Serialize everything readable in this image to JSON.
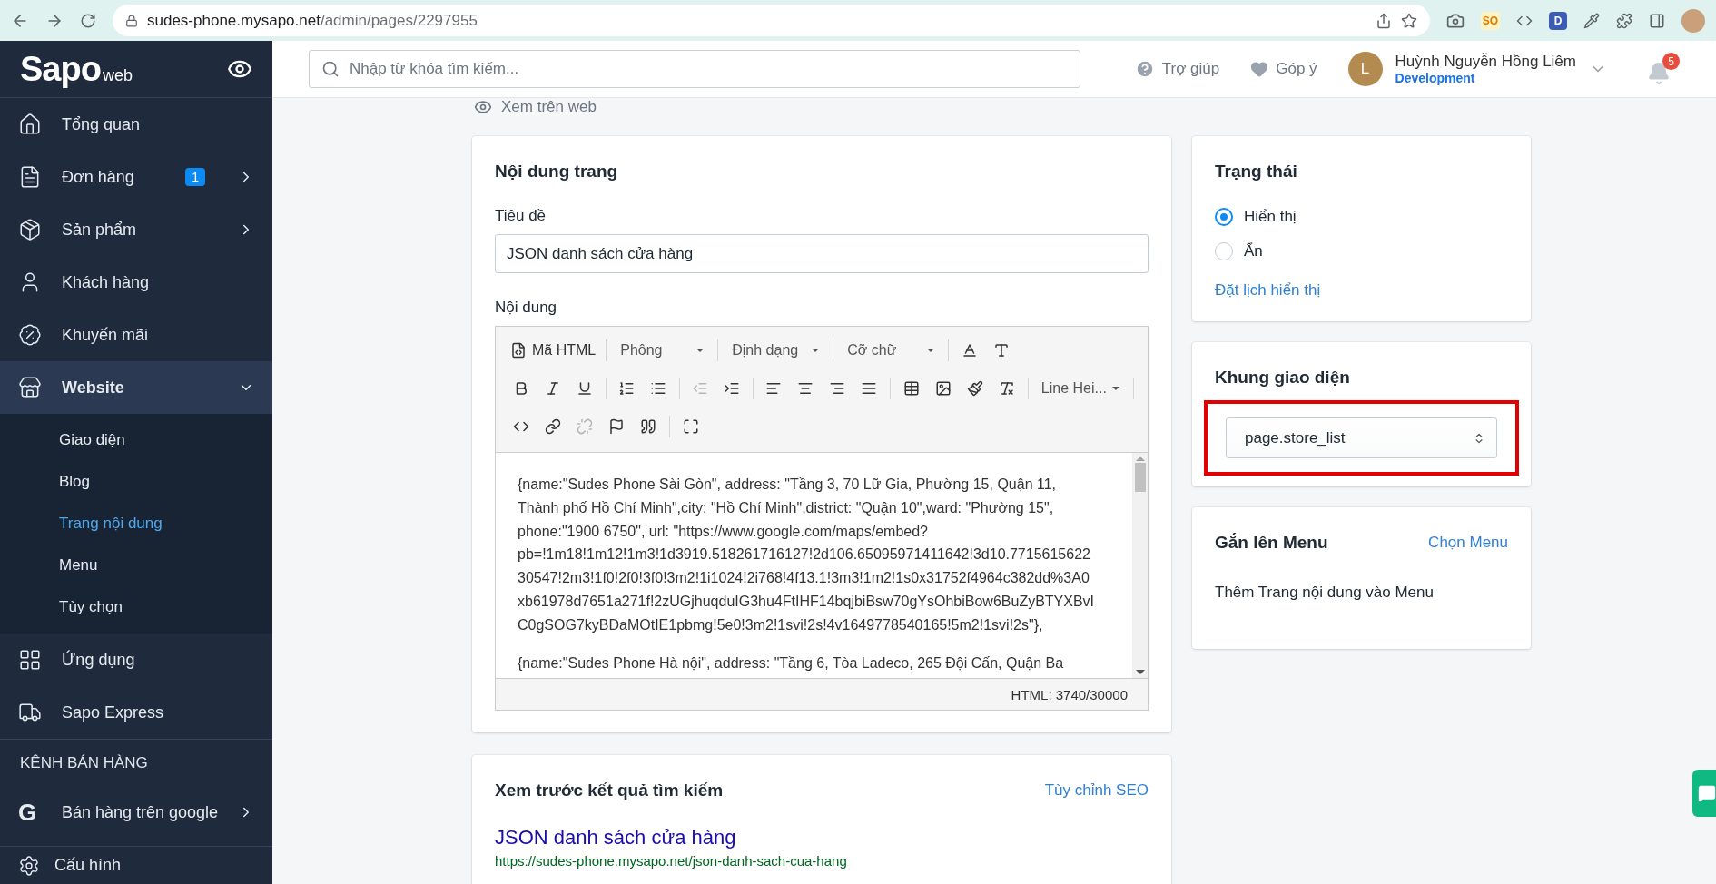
{
  "browser": {
    "url_host": "sudes-phone.mysapo.net",
    "url_path": "/admin/pages/2297955",
    "extensions": [
      "SO",
      "D"
    ]
  },
  "sidebar": {
    "logo": "Sapo",
    "logo_suffix": "web",
    "items": [
      {
        "label": "Tổng quan",
        "selected": false
      },
      {
        "label": "Đơn hàng",
        "badge": "1",
        "expanded": false,
        "selected": false
      },
      {
        "label": "Sản phẩm",
        "expanded": false,
        "selected": false
      },
      {
        "label": "Khách hàng",
        "selected": false
      },
      {
        "label": "Khuyến mãi",
        "selected": false
      },
      {
        "label": "Website",
        "expanded": true,
        "selected": true,
        "children": [
          {
            "label": "Giao diện",
            "selected": false
          },
          {
            "label": "Blog",
            "selected": false
          },
          {
            "label": "Trang nội dung",
            "selected": true
          },
          {
            "label": "Menu",
            "selected": false
          },
          {
            "label": "Tùy chọn",
            "selected": false
          }
        ]
      },
      {
        "label": "Ứng dụng",
        "selected": false
      },
      {
        "label": "Sapo Express",
        "selected": false
      }
    ],
    "channels_heading": "KÊNH BÁN HÀNG",
    "channel_items": [
      {
        "icon_letter": "G",
        "label": "Bán hàng trên google",
        "expanded": false,
        "selected": false
      }
    ],
    "footer": "Cấu hình"
  },
  "header": {
    "search": {
      "placeholder": "Nhập từ khóa tìm kiếm..."
    },
    "help": "Trợ giúp",
    "feedback": "Góp ý",
    "user": {
      "initial": "L",
      "name": "Huỳnh Nguyễn Hồng Liêm",
      "role": "Development"
    },
    "notifications": "5"
  },
  "view_on_web": "Xem trên web",
  "content_card": {
    "title": "Nội dung trang",
    "title_label": "Tiêu đề",
    "title_value": "JSON danh sách cửa hàng",
    "body_label": "Nội dung",
    "toolbar": {
      "html_button": "Mã HTML",
      "dropdowns": [
        "Phông",
        "Định dạng",
        "Cỡ chữ"
      ],
      "line_height": "Line Hei..."
    },
    "paragraphs": [
      [
        "{name:\"Sudes Phone Sài Gòn\", address: \"Tầng 3, 70 Lữ Gia, Phường 15, Quận 11,",
        "Thành phố Hồ Chí Minh\",city: \"Hồ Chí Minh\",district: \"Quận 10\",ward: \"Phường 15\",",
        "phone:\"1900 6750\", url: \"https://www.google.com/maps/embed?",
        "pb=!1m18!1m12!1m3!1d3919.518261716127!2d106.65095971411642!3d10.7715615622",
        "30547!2m3!1f0!2f0!3f0!3m2!1i1024!2i768!4f13.1!3m3!1m2!1s0x31752f4964c382dd%3A0",
        "xb61978d7651a271f!2zUGjhuqduIG3hu4FtIHF14bqjbiBsw70gYsOhbiBow6BuZyBTYXBvI",
        "C0gSOG7kyBDaMOtIE1pbmg!5e0!3m2!1svi!2s!4v1649778540165!5m2!1svi!2s\"},"
      ],
      [
        "{name:\"Sudes Phone Hà nội\", address: \"Tầng 6, Tòa Ladeco, 265 Đội Cấn, Quận Ba"
      ]
    ],
    "counter": "HTML: 3740/30000"
  },
  "seo_card": {
    "title": "Xem trước kết quả tìm kiếm",
    "action": "Tùy chỉnh SEO",
    "preview_title": "JSON danh sách cửa hàng",
    "preview_url": "https://sudes-phone.mysapo.net/json-danh-sach-cua-hang"
  },
  "status_card": {
    "title": "Trạng thái",
    "options": [
      {
        "label": "Hiển thị",
        "selected": true
      },
      {
        "label": "Ẩn",
        "selected": false
      }
    ],
    "schedule_link": "Đặt lịch hiển thị"
  },
  "template_card": {
    "title": "Khung giao diện",
    "value": "page.store_list",
    "highlighted": true
  },
  "menu_card": {
    "title": "Gắn lên Menu",
    "action": "Chọn Menu",
    "description": "Thêm Trang nội dung vào Menu"
  }
}
